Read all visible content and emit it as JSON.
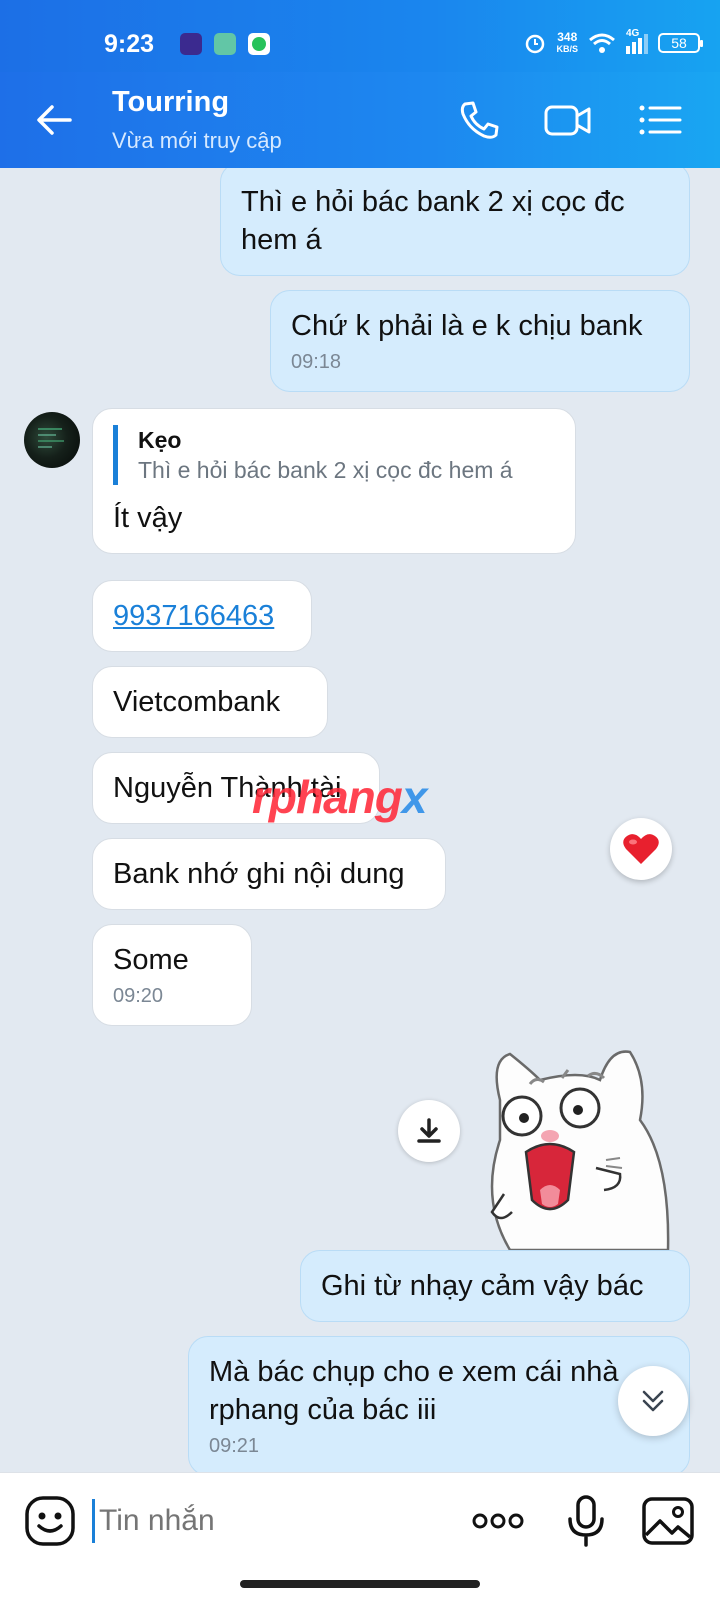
{
  "status_bar": {
    "time": "9:23",
    "net_speed_value": "348",
    "net_speed_unit": "KB/S",
    "network": "4G",
    "battery": "58"
  },
  "header": {
    "title": "Tourring",
    "subtitle": "Vừa mới truy cập",
    "icons": [
      "back-arrow-icon",
      "phone-icon",
      "video-call-icon",
      "menu-list-icon"
    ]
  },
  "messages": [
    {
      "dir": "out",
      "text": "Thì e hỏi bác bank 2 xị cọc đc hem á",
      "time": ""
    },
    {
      "dir": "out",
      "text": "Chứ k phải là e k chịu bank",
      "time": "09:18"
    },
    {
      "dir": "in",
      "quote_name": "Kẹo",
      "quote_text": "Thì e hỏi bác bank 2 xị cọc đc hem á",
      "text": "Ít vậy"
    },
    {
      "dir": "in",
      "text": "9937166463",
      "link": true
    },
    {
      "dir": "in",
      "text": "Vietcombank"
    },
    {
      "dir": "in",
      "text": "Nguyễn Thành tài"
    },
    {
      "dir": "in",
      "text": "Bank nhớ ghi nội dung",
      "reaction": "heart"
    },
    {
      "dir": "in",
      "text": "Some",
      "time": "09:20"
    },
    {
      "dir": "out",
      "text": "Ghi từ nhạy cảm vậy bác"
    },
    {
      "dir": "out",
      "text": "Mà bác chụp cho e xem cái nhà rphang của bác iii",
      "time": "09:21"
    }
  ],
  "watermark": {
    "part1": "rphang",
    "part2": "x"
  },
  "input": {
    "placeholder": "Tin nhắn",
    "icons": [
      "emoji-icon",
      "more-dots-icon",
      "microphone-icon",
      "image-icon"
    ]
  },
  "colors": {
    "header": "#1d88f0",
    "chat_background": "#e2e9f1",
    "outgoing_bubble": "#d5ecfd",
    "incoming_bubble": "#ffffff",
    "link": "#1a80d8",
    "reaction": "#e8202e"
  }
}
